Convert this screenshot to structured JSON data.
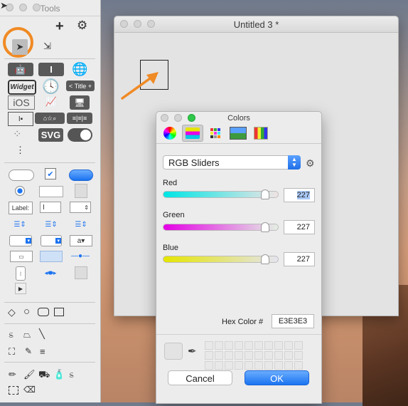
{
  "tools_window": {
    "title": "Tools",
    "widget_label": "Widget",
    "title_label": "< Title +",
    "ios_label": "iOS",
    "svg_label": "SVG",
    "label_label": "Label:"
  },
  "editor_window": {
    "title": "Untitled 3 *"
  },
  "colors_panel": {
    "title": "Colors",
    "mode_select": "RGB Sliders",
    "sliders": [
      {
        "label": "Red",
        "value": "227",
        "fraction": 0.89
      },
      {
        "label": "Green",
        "value": "227",
        "fraction": 0.89
      },
      {
        "label": "Blue",
        "value": "227",
        "fraction": 0.89
      }
    ],
    "hex_label": "Hex Color #",
    "hex_value": "E3E3E3",
    "cancel_label": "Cancel",
    "ok_label": "OK"
  },
  "colors": {
    "accent": "#1c73f0",
    "annotation": "#f08a24",
    "red_track": "#00e5e5",
    "green_track": "#e500e5",
    "blue_track": "#e5e500"
  }
}
